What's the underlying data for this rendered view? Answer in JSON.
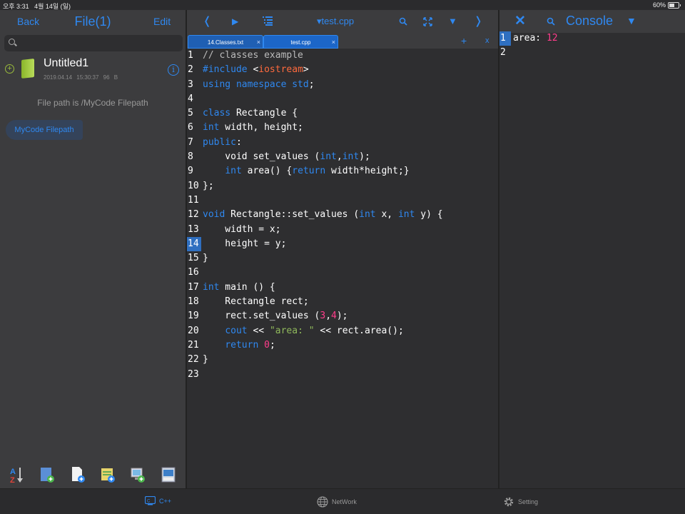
{
  "status_bar": {
    "time": "오후 3:31",
    "date": "4월 14일 (일)",
    "battery": "60%",
    "battery_level": 0.6
  },
  "left_panel": {
    "back_label": "Back",
    "title": "File(1)",
    "edit_label": "Edit",
    "search_placeholder": "",
    "files": [
      {
        "name": "Untitled1",
        "date": "2019.04.14",
        "time": "15:30:37",
        "size": "96 B"
      }
    ],
    "path_text": "File path is /MyCode Filepath",
    "path_chip": "MyCode Filepath",
    "tools": [
      "sort-az-icon",
      "new-folder-icon",
      "new-file-icon",
      "import-file-icon",
      "screen-add-icon",
      "save-window-icon"
    ]
  },
  "editor": {
    "doc_title": "▾test.cpp",
    "tabs": [
      {
        "label": "14.Classes.txt",
        "close": "×"
      },
      {
        "label": "test.cpp",
        "close": "×"
      }
    ],
    "add_tab": "+",
    "close_tab": "x",
    "selected_line": 14,
    "lines": [
      {
        "n": "1",
        "tokens": [
          [
            "cmt",
            "// classes example"
          ]
        ]
      },
      {
        "n": "2",
        "tokens": [
          [
            "pp",
            "#include "
          ],
          [
            "plain",
            "<"
          ],
          [
            "inc",
            "iostream"
          ],
          [
            "plain",
            ">"
          ]
        ]
      },
      {
        "n": "3",
        "tokens": [
          [
            "kw",
            "using namespace std"
          ],
          [
            "plain",
            ";"
          ]
        ]
      },
      {
        "n": "4",
        "tokens": []
      },
      {
        "n": "5",
        "tokens": [
          [
            "kw",
            "class"
          ],
          [
            "plain",
            " Rectangle {"
          ]
        ]
      },
      {
        "n": "6",
        "tokens": [
          [
            "kw",
            "int"
          ],
          [
            "plain",
            " width, height;"
          ]
        ]
      },
      {
        "n": "7",
        "tokens": [
          [
            "kw",
            "public"
          ],
          [
            "plain",
            ":"
          ]
        ]
      },
      {
        "n": "8",
        "tokens": [
          [
            "plain",
            "    void set_values ("
          ],
          [
            "kw",
            "int"
          ],
          [
            "plain",
            ","
          ],
          [
            "kw",
            "int"
          ],
          [
            "plain",
            ");"
          ]
        ]
      },
      {
        "n": "9",
        "tokens": [
          [
            "plain",
            "    "
          ],
          [
            "kw",
            "int"
          ],
          [
            "plain",
            " area() {"
          ],
          [
            "kw",
            "return"
          ],
          [
            "plain",
            " width*height;}"
          ]
        ]
      },
      {
        "n": "10",
        "tokens": [
          [
            "plain",
            "};"
          ]
        ]
      },
      {
        "n": "11",
        "tokens": []
      },
      {
        "n": "12",
        "tokens": [
          [
            "kw",
            "void"
          ],
          [
            "plain",
            " Rectangle::set_values ("
          ],
          [
            "kw",
            "int"
          ],
          [
            "plain",
            " x, "
          ],
          [
            "kw",
            "int"
          ],
          [
            "plain",
            " y) {"
          ]
        ]
      },
      {
        "n": "13",
        "tokens": [
          [
            "plain",
            "    width = x;"
          ]
        ]
      },
      {
        "n": "14",
        "tokens": [
          [
            "plain",
            "    height = y;"
          ]
        ]
      },
      {
        "n": "15",
        "tokens": [
          [
            "plain",
            "}"
          ]
        ]
      },
      {
        "n": "16",
        "tokens": []
      },
      {
        "n": "17",
        "tokens": [
          [
            "kw",
            "int"
          ],
          [
            "plain",
            " main () {"
          ]
        ]
      },
      {
        "n": "18",
        "tokens": [
          [
            "plain",
            "    Rectangle rect;"
          ]
        ]
      },
      {
        "n": "19",
        "tokens": [
          [
            "plain",
            "    rect.set_values ("
          ],
          [
            "num",
            "3"
          ],
          [
            "plain",
            ","
          ],
          [
            "num",
            "4"
          ],
          [
            "plain",
            ");"
          ]
        ]
      },
      {
        "n": "20",
        "tokens": [
          [
            "plain",
            "    "
          ],
          [
            "kw",
            "cout"
          ],
          [
            "plain",
            " << "
          ],
          [
            "str",
            "\"area: \""
          ],
          [
            "plain",
            " << rect.area();"
          ]
        ]
      },
      {
        "n": "21",
        "tokens": [
          [
            "plain",
            "    "
          ],
          [
            "kw",
            "return"
          ],
          [
            "plain",
            " "
          ],
          [
            "num",
            "0"
          ],
          [
            "plain",
            ";"
          ]
        ]
      },
      {
        "n": "22",
        "tokens": [
          [
            "plain",
            "}"
          ]
        ]
      },
      {
        "n": "23",
        "tokens": []
      }
    ]
  },
  "console": {
    "title": "Console",
    "close": "✕",
    "dropdown": "▼",
    "lines": [
      {
        "n": "1",
        "tokens": [
          [
            "plain",
            "area: "
          ],
          [
            "num",
            "12"
          ]
        ]
      },
      {
        "n": "2",
        "tokens": []
      }
    ]
  },
  "bottom_tabs": [
    {
      "label": "C++",
      "icon": "cpp-icon",
      "active": true
    },
    {
      "label": "NetWork",
      "icon": "globe-icon",
      "active": false
    },
    {
      "label": "Setting",
      "icon": "gear-icon",
      "active": false
    }
  ]
}
